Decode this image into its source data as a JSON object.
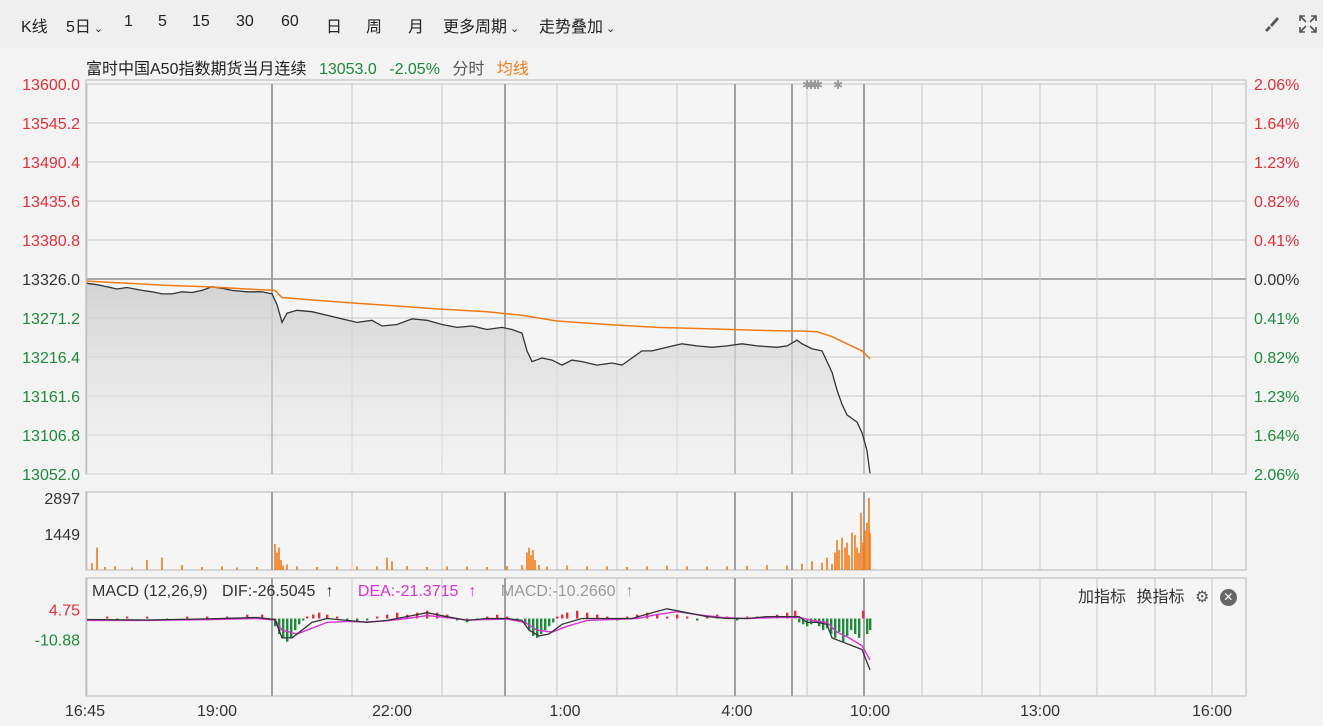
{
  "toolbar": {
    "kline": "K线",
    "period_5d": "5日",
    "p1": "1",
    "p5": "5",
    "p15": "15",
    "p30": "30",
    "p60": "60",
    "day": "日",
    "week": "周",
    "month": "月",
    "more": "更多周期",
    "overlay": "走势叠加"
  },
  "header": {
    "name": "富时中国A50指数期货当月连续",
    "price": "13053.0",
    "change": "-2.05%",
    "timeshare": "分时",
    "avg": "均线"
  },
  "colors": {
    "up": "#e0303a",
    "down": "#1d8a3c",
    "price_line": "#333333",
    "avg_line": "#f07a18",
    "volume": "#f07a18",
    "dea": "#d633d6",
    "grid": "#c8c8c8"
  },
  "macd": {
    "label": "MACD (12,26,9)",
    "dif": "DIF:-26.5045",
    "dea": "DEA:-21.3715",
    "macd": "MACD:-10.2660",
    "add": "加指标",
    "swap": "换指标"
  },
  "chart_data": [
    {
      "type": "line",
      "title": "富时中国A50指数期货当月连续",
      "x_ticks": [
        "16:45",
        "19:00",
        "22:00",
        "1:00",
        "4:00",
        "10:00",
        "13:00",
        "16:00"
      ],
      "y_ticks_left": [
        "13600.0",
        "13545.2",
        "13490.4",
        "13435.6",
        "13380.8",
        "13326.0",
        "13271.2",
        "13216.4",
        "13161.6",
        "13106.8",
        "13052.0"
      ],
      "y_ticks_right": [
        "2.06%",
        "1.64%",
        "1.23%",
        "0.82%",
        "0.41%",
        "0.00%",
        "0.41%",
        "0.82%",
        "1.23%",
        "1.64%",
        "2.06%"
      ],
      "ylim": [
        13052.0,
        13600.0
      ],
      "reference_close": 13326.0,
      "series": [
        {
          "name": "分时",
          "points": [
            [
              0,
              13320
            ],
            [
              10,
              13318
            ],
            [
              20,
              13315
            ],
            [
              30,
              13312
            ],
            [
              40,
              13314
            ],
            [
              55,
              13310
            ],
            [
              65,
              13308
            ],
            [
              75,
              13305
            ],
            [
              85,
              13305
            ],
            [
              95,
              13308
            ],
            [
              105,
              13307
            ],
            [
              115,
              13310
            ],
            [
              125,
              13315
            ],
            [
              135,
              13313
            ],
            [
              145,
              13310
            ],
            [
              160,
              13308
            ],
            [
              175,
              13308
            ],
            [
              185,
              13305
            ],
            [
              190,
              13290
            ],
            [
              195,
              13265
            ],
            [
              200,
              13278
            ],
            [
              210,
              13282
            ],
            [
              225,
              13280
            ],
            [
              240,
              13275
            ],
            [
              255,
              13270
            ],
            [
              270,
              13265
            ],
            [
              285,
              13268
            ],
            [
              295,
              13260
            ],
            [
              310,
              13262
            ],
            [
              325,
              13270
            ],
            [
              340,
              13268
            ],
            [
              355,
              13262
            ],
            [
              370,
              13258
            ],
            [
              385,
              13260
            ],
            [
              400,
              13255
            ],
            [
              415,
              13258
            ],
            [
              425,
              13255
            ],
            [
              435,
              13250
            ],
            [
              440,
              13225
            ],
            [
              445,
              13210
            ],
            [
              455,
              13215
            ],
            [
              465,
              13212
            ],
            [
              475,
              13205
            ],
            [
              485,
              13212
            ],
            [
              495,
              13210
            ],
            [
              510,
              13205
            ],
            [
              525,
              13208
            ],
            [
              535,
              13205
            ],
            [
              545,
              13215
            ],
            [
              555,
              13225
            ],
            [
              565,
              13225
            ],
            [
              580,
              13230
            ],
            [
              595,
              13235
            ],
            [
              610,
              13232
            ],
            [
              625,
              13230
            ],
            [
              640,
              13232
            ],
            [
              655,
              13235
            ],
            [
              670,
              13232
            ],
            [
              690,
              13230
            ],
            [
              700,
              13232
            ],
            [
              710,
              13240
            ],
            [
              715,
              13235
            ],
            [
              725,
              13228
            ],
            [
              735,
              13225
            ],
            [
              745,
              13195
            ],
            [
              750,
              13170
            ],
            [
              755,
              13150
            ],
            [
              760,
              13135
            ],
            [
              770,
              13125
            ],
            [
              775,
              13110
            ],
            [
              780,
              13085
            ],
            [
              783,
              13053
            ]
          ]
        },
        {
          "name": "均线",
          "points": [
            [
              0,
              13323
            ],
            [
              40,
              13320
            ],
            [
              80,
              13317
            ],
            [
              120,
              13315
            ],
            [
              160,
              13312
            ],
            [
              188,
              13310
            ],
            [
              195,
              13300
            ],
            [
              230,
              13296
            ],
            [
              270,
              13292
            ],
            [
              310,
              13288
            ],
            [
              350,
              13284
            ],
            [
              400,
              13280
            ],
            [
              435,
              13275
            ],
            [
              470,
              13267
            ],
            [
              520,
              13262
            ],
            [
              570,
              13258
            ],
            [
              620,
              13256
            ],
            [
              670,
              13254
            ],
            [
              700,
              13253
            ],
            [
              715,
              13253
            ],
            [
              730,
              13252
            ],
            [
              745,
              13245
            ],
            [
              760,
              13235
            ],
            [
              775,
              13225
            ],
            [
              783,
              13214
            ]
          ]
        }
      ]
    },
    {
      "type": "bar",
      "title": "",
      "y_ticks": [
        "2897",
        "1449"
      ],
      "ylim": [
        0,
        2897
      ],
      "x": [
        5,
        10,
        18,
        28,
        45,
        60,
        75,
        95,
        115,
        135,
        150,
        170,
        188,
        190,
        192,
        194,
        196,
        200,
        210,
        230,
        250,
        270,
        290,
        300,
        305,
        320,
        340,
        360,
        380,
        400,
        420,
        435,
        440,
        442,
        444,
        446,
        448,
        452,
        460,
        480,
        500,
        520,
        540,
        560,
        580,
        600,
        620,
        640,
        660,
        680,
        700,
        715,
        725,
        735,
        740,
        745,
        748,
        750,
        752,
        755,
        758,
        760,
        762,
        765,
        768,
        770,
        772,
        774,
        776,
        778,
        780,
        782,
        783
      ],
      "values": [
        280,
        900,
        120,
        150,
        100,
        400,
        500,
        200,
        120,
        150,
        100,
        120,
        1050,
        700,
        900,
        400,
        180,
        220,
        150,
        120,
        140,
        150,
        150,
        500,
        350,
        160,
        120,
        150,
        140,
        120,
        160,
        200,
        700,
        900,
        600,
        800,
        400,
        200,
        140,
        180,
        150,
        150,
        120,
        150,
        180,
        150,
        140,
        150,
        170,
        200,
        180,
        250,
        350,
        300,
        500,
        250,
        700,
        1200,
        800,
        1300,
        900,
        1100,
        600,
        1500,
        1400,
        900,
        700,
        2300,
        1100,
        1600,
        1900,
        2897,
        1500
      ]
    },
    {
      "type": "bar",
      "title": "MACD (12,26,9)",
      "y_ticks": [
        "4.75",
        "-10.88"
      ],
      "ylim": [
        -40,
        8
      ],
      "hist_x": [
        20,
        30,
        40,
        60,
        80,
        100,
        120,
        140,
        160,
        175,
        188,
        192,
        196,
        200,
        204,
        208,
        212,
        216,
        220,
        226,
        232,
        240,
        250,
        260,
        270,
        280,
        290,
        300,
        310,
        320,
        330,
        340,
        350,
        360,
        370,
        380,
        390,
        400,
        410,
        420,
        430,
        438,
        442,
        446,
        450,
        454,
        458,
        462,
        466,
        470,
        475,
        480,
        490,
        500,
        510,
        520,
        530,
        540,
        550,
        560,
        570,
        580,
        590,
        600,
        610,
        620,
        630,
        640,
        650,
        660,
        670,
        680,
        690,
        700,
        708,
        712,
        716,
        720,
        724,
        728,
        732,
        736,
        740,
        744,
        748,
        752,
        756,
        760,
        764,
        768,
        772,
        776,
        780,
        783
      ],
      "hist_values": [
        1,
        -1,
        1,
        1,
        -1,
        1,
        1,
        1,
        2,
        2,
        -4,
        -8,
        -10,
        -12,
        -10,
        -6,
        -3,
        -1,
        1,
        2,
        3,
        2,
        1,
        -1,
        -2,
        -1,
        1,
        2,
        3,
        2,
        3,
        4,
        3,
        2,
        -1,
        -2,
        -1,
        1,
        2,
        1,
        -1,
        -3,
        -6,
        -9,
        -10,
        -8,
        -6,
        -4,
        -2,
        1,
        2,
        3,
        4,
        3,
        2,
        1,
        -1,
        1,
        2,
        3,
        2,
        1,
        2,
        1,
        -1,
        1,
        2,
        1,
        -1,
        1,
        1,
        1,
        2,
        3,
        4,
        -2,
        -3,
        -4,
        -3,
        -2,
        -4,
        -6,
        -5,
        -8,
        -10,
        -7,
        -12,
        -9,
        -6,
        -8,
        -10,
        4,
        -8,
        -6
      ],
      "dif_points": [
        [
          0,
          -0.5
        ],
        [
          60,
          -0.8
        ],
        [
          120,
          -0.2
        ],
        [
          170,
          0.5
        ],
        [
          188,
          -0.5
        ],
        [
          195,
          -10
        ],
        [
          205,
          -10
        ],
        [
          215,
          -6
        ],
        [
          225,
          -2
        ],
        [
          240,
          0
        ],
        [
          260,
          -1
        ],
        [
          280,
          -2
        ],
        [
          300,
          -1
        ],
        [
          320,
          1
        ],
        [
          340,
          3
        ],
        [
          360,
          1
        ],
        [
          380,
          -1
        ],
        [
          400,
          0
        ],
        [
          420,
          0
        ],
        [
          435,
          -1
        ],
        [
          442,
          -6
        ],
        [
          452,
          -9
        ],
        [
          462,
          -8
        ],
        [
          475,
          -3
        ],
        [
          495,
          0
        ],
        [
          520,
          0
        ],
        [
          545,
          0
        ],
        [
          565,
          3
        ],
        [
          580,
          5
        ],
        [
          600,
          3
        ],
        [
          620,
          1
        ],
        [
          640,
          0
        ],
        [
          660,
          0
        ],
        [
          680,
          1
        ],
        [
          700,
          1
        ],
        [
          712,
          1
        ],
        [
          720,
          -2
        ],
        [
          730,
          -2
        ],
        [
          740,
          -3
        ],
        [
          745,
          -10
        ],
        [
          755,
          -12
        ],
        [
          765,
          -14
        ],
        [
          775,
          -16
        ],
        [
          783,
          -26.5045
        ]
      ],
      "dea_points": [
        [
          0,
          -1
        ],
        [
          60,
          -1
        ],
        [
          120,
          -0.6
        ],
        [
          170,
          0
        ],
        [
          188,
          -0.8
        ],
        [
          195,
          -6
        ],
        [
          210,
          -8
        ],
        [
          225,
          -5
        ],
        [
          240,
          -2
        ],
        [
          260,
          -1.5
        ],
        [
          280,
          -1.8
        ],
        [
          300,
          -1.2
        ],
        [
          320,
          0
        ],
        [
          340,
          1.5
        ],
        [
          360,
          0.5
        ],
        [
          380,
          -0.8
        ],
        [
          400,
          -0.5
        ],
        [
          420,
          -0.3
        ],
        [
          438,
          -2
        ],
        [
          450,
          -6
        ],
        [
          465,
          -7
        ],
        [
          480,
          -4
        ],
        [
          500,
          -1
        ],
        [
          525,
          -0.5
        ],
        [
          550,
          0
        ],
        [
          570,
          2
        ],
        [
          590,
          3.5
        ],
        [
          610,
          2
        ],
        [
          635,
          0.5
        ],
        [
          660,
          0
        ],
        [
          690,
          0.5
        ],
        [
          712,
          0.6
        ],
        [
          725,
          -1
        ],
        [
          740,
          -2
        ],
        [
          750,
          -7
        ],
        [
          762,
          -10
        ],
        [
          775,
          -14
        ],
        [
          783,
          -21.3715
        ]
      ]
    }
  ]
}
